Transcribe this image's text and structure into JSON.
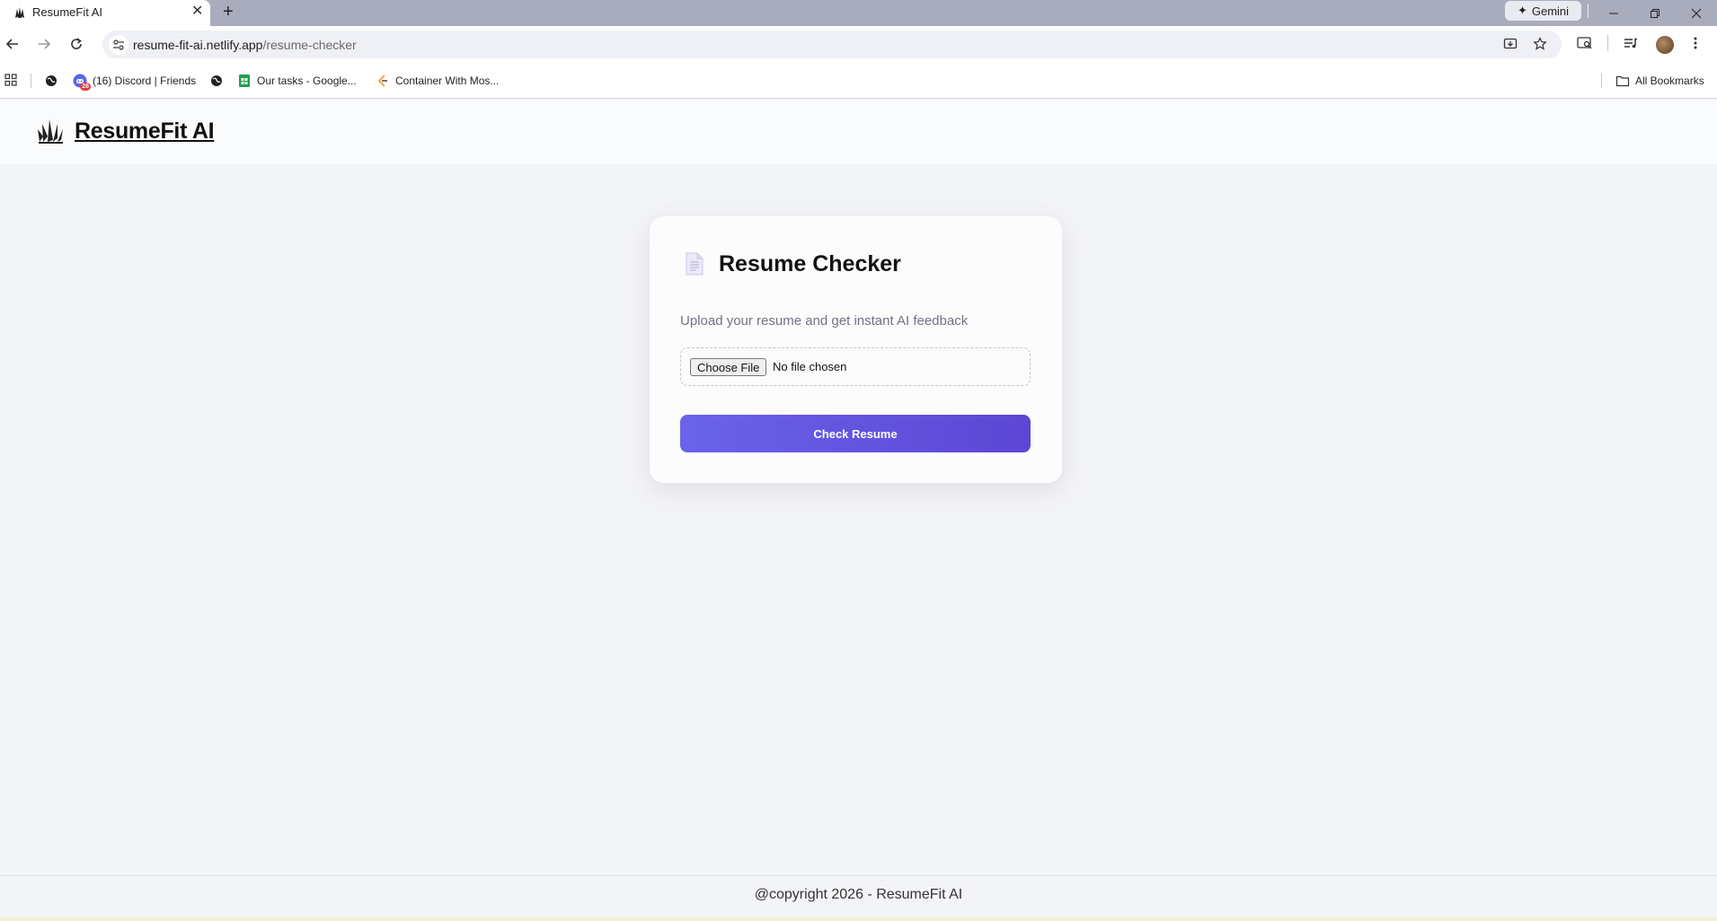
{
  "browser": {
    "tab_title": "ResumeFit AI",
    "gemini_label": "Gemini",
    "url_host": "resume-fit-ai.netlify.app",
    "url_path": "/resume-checker",
    "bookmarks": [
      {
        "label": ""
      },
      {
        "label": "(16) Discord | Friends"
      },
      {
        "label": ""
      },
      {
        "label": "Our tasks - Google..."
      },
      {
        "label": "Container With Mos..."
      }
    ],
    "all_bookmarks_label": "All Bookmarks",
    "discord_badge": "26"
  },
  "site": {
    "title": "ResumeFit AI"
  },
  "card": {
    "title": "Resume Checker",
    "subtitle": "Upload your resume and get instant AI feedback",
    "choose_file_label": "Choose File",
    "no_file_text": "No file chosen",
    "check_button_label": "Check Resume"
  },
  "footer": {
    "text": "@copyright 2026 - ResumeFit AI"
  },
  "colors": {
    "accent": "#6159e0",
    "page_bg": "#f3f4f7"
  }
}
